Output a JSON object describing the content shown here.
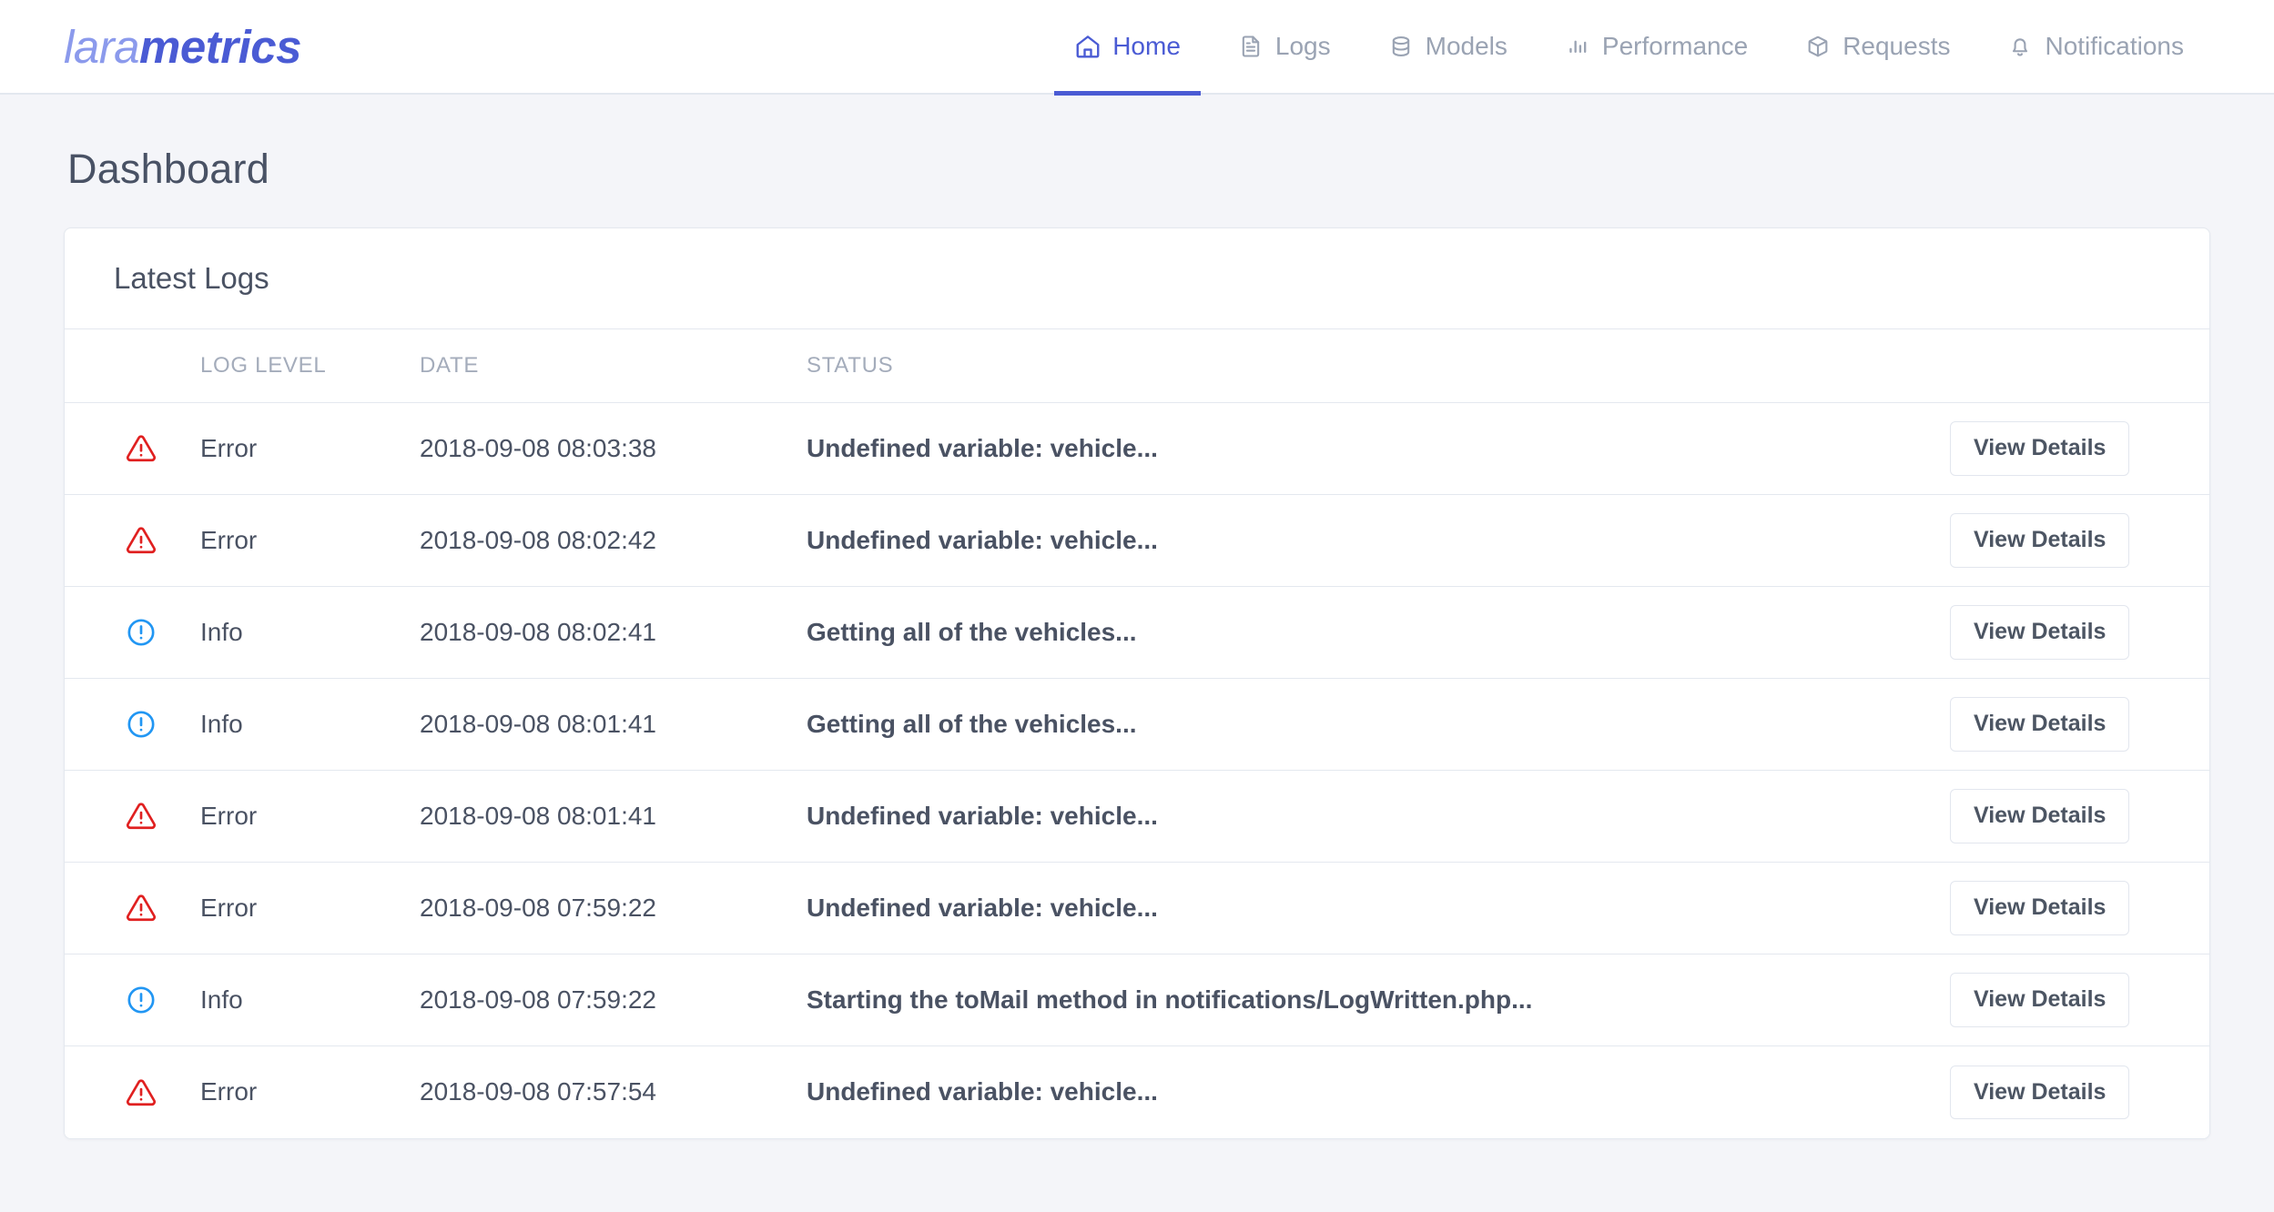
{
  "brand": {
    "text_light": "lara",
    "text_bold": "metrics",
    "color_light": "#8b9aec",
    "color_bold": "#4a5bd4"
  },
  "nav": {
    "items": [
      {
        "label": "Home",
        "icon": "home-icon",
        "active": true
      },
      {
        "label": "Logs",
        "icon": "document-icon",
        "active": false
      },
      {
        "label": "Models",
        "icon": "database-icon",
        "active": false
      },
      {
        "label": "Performance",
        "icon": "bar-chart-icon",
        "active": false
      },
      {
        "label": "Requests",
        "icon": "package-icon",
        "active": false
      },
      {
        "label": "Notifications",
        "icon": "bell-icon",
        "active": false
      }
    ],
    "active_color": "#4a5bd4",
    "inactive_color": "#9aa3b3"
  },
  "page": {
    "title": "Dashboard",
    "background": "#f4f5f9"
  },
  "card": {
    "title": "Latest Logs"
  },
  "table": {
    "headers": {
      "icon": "",
      "level": "LOG LEVEL",
      "date": "DATE",
      "status": "STATUS",
      "action": ""
    },
    "action_label": "View Details",
    "level_colors": {
      "Error": "#e02020",
      "Info": "#2196f3"
    },
    "rows": [
      {
        "icon": "warning-triangle-icon",
        "level": "Error",
        "date": "2018-09-08 08:03:38",
        "status": "Undefined variable: vehicle...",
        "action": "View Details"
      },
      {
        "icon": "warning-triangle-icon",
        "level": "Error",
        "date": "2018-09-08 08:02:42",
        "status": "Undefined variable: vehicle...",
        "action": "View Details"
      },
      {
        "icon": "info-circle-icon",
        "level": "Info",
        "date": "2018-09-08 08:02:41",
        "status": "Getting all of the vehicles...",
        "action": "View Details"
      },
      {
        "icon": "info-circle-icon",
        "level": "Info",
        "date": "2018-09-08 08:01:41",
        "status": "Getting all of the vehicles...",
        "action": "View Details"
      },
      {
        "icon": "warning-triangle-icon",
        "level": "Error",
        "date": "2018-09-08 08:01:41",
        "status": "Undefined variable: vehicle...",
        "action": "View Details"
      },
      {
        "icon": "warning-triangle-icon",
        "level": "Error",
        "date": "2018-09-08 07:59:22",
        "status": "Undefined variable: vehicle...",
        "action": "View Details"
      },
      {
        "icon": "info-circle-icon",
        "level": "Info",
        "date": "2018-09-08 07:59:22",
        "status": "Starting the toMail method in notifications/LogWritten.php...",
        "action": "View Details"
      },
      {
        "icon": "warning-triangle-icon",
        "level": "Error",
        "date": "2018-09-08 07:57:54",
        "status": "Undefined variable: vehicle...",
        "action": "View Details"
      }
    ]
  }
}
